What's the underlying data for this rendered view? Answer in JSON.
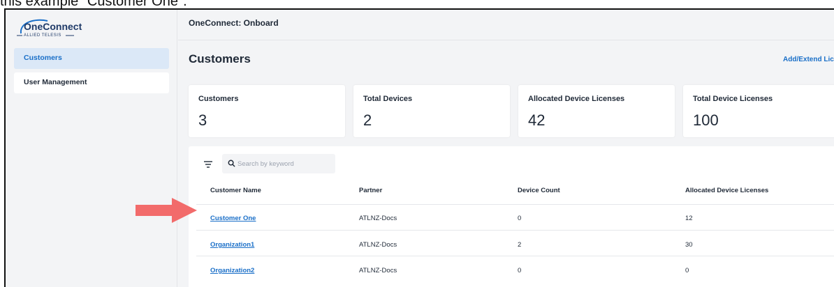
{
  "caption": "this example \"Customer One\".",
  "sidebar": {
    "logo_text": "OneConnect",
    "logo_subtitle": "ALLIED TELESIS",
    "items": [
      {
        "label": "Customers"
      },
      {
        "label": "User Management"
      }
    ]
  },
  "topbar": {
    "title": "OneConnect: Onboard"
  },
  "page": {
    "title": "Customers",
    "add_link": "Add/Extend Lice"
  },
  "cards": [
    {
      "label": "Customers",
      "value": "3"
    },
    {
      "label": "Total Devices",
      "value": "2"
    },
    {
      "label": "Allocated Device Licenses",
      "value": "42"
    },
    {
      "label": "Total Device Licenses",
      "value": "100"
    }
  ],
  "search": {
    "placeholder": "Search by keyword"
  },
  "table": {
    "columns": [
      "Customer Name",
      "Partner",
      "Device Count",
      "Allocated Device Licenses"
    ],
    "rows": [
      {
        "name": "Customer One",
        "partner": "ATLNZ-Docs",
        "device_count": "0",
        "allocated": "12"
      },
      {
        "name": "Organization1",
        "partner": "ATLNZ-Docs",
        "device_count": "2",
        "allocated": "30"
      },
      {
        "name": "Organization2",
        "partner": "ATLNZ-Docs",
        "device_count": "0",
        "allocated": "0"
      }
    ]
  },
  "colors": {
    "accent": "#1a6fc8",
    "arrow": "#f26b6b",
    "active_nav_bg": "#dbe8f7"
  },
  "icons": {
    "filter": "filter-icon",
    "search": "search-icon",
    "arrow": "arrow-right-icon"
  }
}
